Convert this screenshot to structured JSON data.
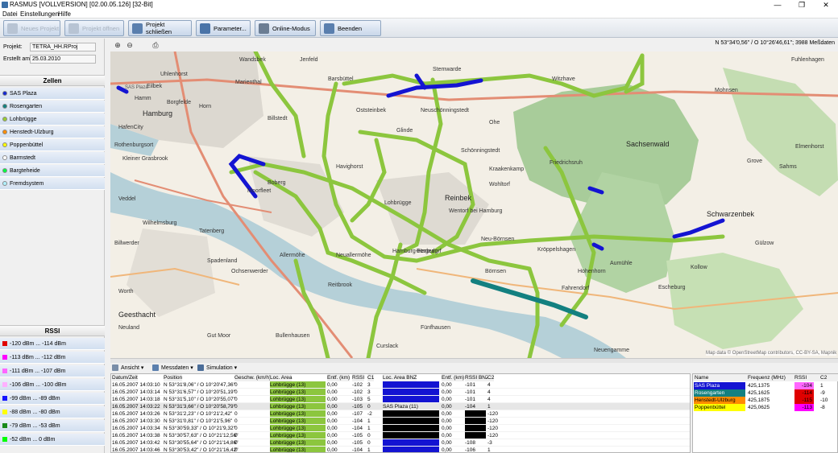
{
  "window": {
    "title": "RASMUS [VOLLVERSION] [02.00.05.126] [32-Bit]",
    "minimize": "—",
    "maximize": "❐",
    "close": "✕"
  },
  "menu": [
    "Datei",
    "Einstellungen",
    "Hilfe"
  ],
  "toolbar": [
    {
      "label": "Neues Projekt",
      "enabled": false,
      "icon": "new-project-icon"
    },
    {
      "label": "Projekt öffnen",
      "enabled": false,
      "icon": "open-project-icon"
    },
    {
      "label": "Projekt schließen",
      "enabled": true,
      "icon": "close-project-icon"
    },
    {
      "label": "Parameter...",
      "enabled": true,
      "icon": "parameter-icon"
    },
    {
      "label": "Online-Modus",
      "enabled": true,
      "icon": "antenna-icon"
    },
    {
      "label": "Beenden",
      "enabled": true,
      "icon": "exit-icon"
    }
  ],
  "project": {
    "label": "Projekt:",
    "value": "TETRA_HH.RProj",
    "created_label": "Erstellt am:",
    "created": "25.03.2010"
  },
  "cells_header": "Zellen",
  "cells": [
    {
      "name": "SAS Plaza",
      "color": "#1428d2"
    },
    {
      "name": "Rosengarten",
      "color": "#138080"
    },
    {
      "name": "Lohbrügge",
      "color": "#9acd32"
    },
    {
      "name": "Henstedt-Ulzburg",
      "color": "#ff8c00"
    },
    {
      "name": "Poppenbüttel",
      "color": "#ffff00"
    },
    {
      "name": "Barmstedt",
      "color": "#ffffff"
    },
    {
      "name": "Bargteheide",
      "color": "#00ff40"
    },
    {
      "name": "Fremdsystem",
      "color": "#b0f0ff"
    }
  ],
  "rssi_header": "RSSI",
  "rssi": [
    {
      "label": "-120 dBm ... -114 dBm",
      "color": "#e00000"
    },
    {
      "label": "-113 dBm ... -112 dBm",
      "color": "#ff00ff"
    },
    {
      "label": "-111 dBm ... -107 dBm",
      "color": "#ff66ff"
    },
    {
      "label": "-106 dBm ... -100 dBm",
      "color": "#ffb0ff"
    },
    {
      "label": "-99 dBm ... -89 dBm",
      "color": "#1414ff"
    },
    {
      "label": "-88 dBm ... -80 dBm",
      "color": "#ffff00"
    },
    {
      "label": "-79 dBm ... -53 dBm",
      "color": "#1a8a1a"
    },
    {
      "label": "-52 dBm ... 0 dBm",
      "color": "#00ff00"
    }
  ],
  "map": {
    "coords": "N 53°34'0,56\" / O 10°26'46,61\"; 3988 Meßdaten",
    "attribution": "Map data © OpenStreetMap contributors, CC-BY-SA, Mapnik",
    "places": [
      "Wandsbek",
      "Uhlenhorst",
      "Eilbek",
      "Jenfeld",
      "Stemwarde",
      "Witzhave",
      "Fuhlenhagen",
      "Hamm",
      "Marienthal",
      "Barsbüttel",
      "Borgfelde",
      "Horn",
      "Mohnsen",
      "HafenCity",
      "Hamburg",
      "Billstedt",
      "Oststeinbek",
      "Neuschönningstedt",
      "Ohe",
      "Rothenburgsort",
      "Glinde",
      "Schönningstedt",
      "Sachsenwald",
      "Kleiner Grasbrook",
      "Havighorst",
      "Kraakenkamp",
      "Friedrichsruh",
      "Grove",
      "Sahms",
      "Boberg",
      "Wohltorf",
      "Elmenhorst",
      "Reinbek",
      "Veddel",
      "Lohbrügge",
      "Wentorf bei Hamburg",
      "Schwarzenbek",
      "Wilhelmsburg",
      "Billwerder",
      "Tatenberg",
      "Neu-Börnsen",
      "Kröppelshagen",
      "Gülzow",
      "Moorfleet",
      "Aumühle",
      "Spadenland",
      "Allermöhe",
      "Neuallermöhe",
      "Bergedorf",
      "Ochsenwerder",
      "Börnsen",
      "Hohenhorn",
      "Kollow",
      "Reitbrook",
      "Fahrendorf",
      "Escheburg",
      "Worth",
      "Neuland",
      "Gut Moor",
      "Bullenhausen",
      "Fünfhausen",
      "Curslack",
      "Neuengamme",
      "Geesthacht",
      "Hamburg-Harburg"
    ],
    "place_labels": {
      "sas": "SAS Plaza"
    }
  },
  "detail_toolbar": {
    "view": "Ansicht",
    "data": "Messdaten",
    "sim": "Simulation"
  },
  "table": {
    "headers": [
      "Datum/Zeit",
      "Position",
      "Geschw. (km/h)",
      "Loc. Area",
      "Entf. (km)",
      "RSSI",
      "C1",
      "Loc. Area BNZ",
      "Entf. (km)",
      "RSSI BNZ",
      "C2"
    ],
    "rows": [
      [
        "16.05.2007 14:03:10",
        "N 53°31'8,06\" / O 10°20'47,36\"",
        "0",
        "Lohbrügge (13)",
        "0,00",
        "-102",
        "3",
        "SAS Plaza (11)",
        "0,00",
        "-101",
        "4"
      ],
      [
        "16.05.2007 14:03:14",
        "N 53°31'6,57\" / O 10°20'51,19\"",
        "0",
        "Lohbrügge (13)",
        "0,00",
        "-102",
        "3",
        "SAS Plaza (11)",
        "0,00",
        "-101",
        "4"
      ],
      [
        "16.05.2007 14:03:18",
        "N 53°31'5,10\" / O 10°20'55,07\"",
        "0",
        "Lohbrügge (13)",
        "0,00",
        "-103",
        "5",
        "SAS Plaza (11)",
        "0,00",
        "-101",
        "4"
      ],
      [
        "16.05.2007 14:03:22",
        "N 53°31'3,66\" / O 10°20'58,79\"",
        "0",
        "Lohbrügge (13)",
        "0,00",
        "-105",
        "0",
        "SAS Plaza (11)",
        "0,00",
        "-104",
        "1"
      ],
      [
        "16.05.2007 14:03:26",
        "N 53°31'2,23\" / O 10°21'2,42\"",
        "0",
        "Lohbrügge (13)",
        "0,00",
        "-107",
        "-2",
        "",
        "0,00",
        "",
        "-120"
      ],
      [
        "16.05.2007 14:03:30",
        "N 53°31'0,81\" / O 10°21'5,96\"",
        "0",
        "Lohbrügge (13)",
        "0,00",
        "-104",
        "1",
        "",
        "0,00",
        "",
        "-120"
      ],
      [
        "16.05.2007 14:03:34",
        "N 53°30'59,33\" / O 10°21'9,32\"",
        "0",
        "Lohbrügge (13)",
        "0,00",
        "-104",
        "1",
        "",
        "0,00",
        "",
        "-120"
      ],
      [
        "16.05.2007 14:03:38",
        "N 53°30'57,63\" / O 10°21'12,56\"",
        "0",
        "Lohbrügge (13)",
        "0,00",
        "-105",
        "0",
        "",
        "0,00",
        "",
        "-120"
      ],
      [
        "16.05.2007 14:03:42",
        "N 53°30'55,64\" / O 10°21'14,86\"",
        "0",
        "Lohbrügge (13)",
        "0,00",
        "-105",
        "0",
        "SAS Plaza (11)",
        "0,00",
        "-108",
        "-3"
      ],
      [
        "16.05.2007 14:03:46",
        "N 53°30'53,42\" / O 10°21'16,42\"",
        "0",
        "Lohbrügge (13)",
        "0,00",
        "-104",
        "1",
        "SAS Plaza (11)",
        "0,00",
        "-106",
        "1"
      ]
    ]
  },
  "neighbors": {
    "headers": [
      "Name",
      "Frequenz (MHz)",
      "RSSI",
      "C2"
    ],
    "rows": [
      {
        "name": "SAS Plaza",
        "freq": "425,1375",
        "rssi": "-104",
        "c2": "1",
        "color": "#1414d2",
        "rcolor": "#ff66ff"
      },
      {
        "name": "Rosengarten",
        "freq": "425,1625",
        "rssi": "-114",
        "c2": "-9",
        "color": "#138080",
        "rcolor": "#e00000"
      },
      {
        "name": "Henstedt-Ulzburg",
        "freq": "425,1875",
        "rssi": "-115",
        "c2": "-10",
        "color": "#ff8c00",
        "rcolor": "#e00000"
      },
      {
        "name": "Poppenbüttel",
        "freq": "425,0625",
        "rssi": "-113",
        "c2": "-8",
        "color": "#ffff00",
        "rcolor": "#ff00ff"
      }
    ]
  }
}
